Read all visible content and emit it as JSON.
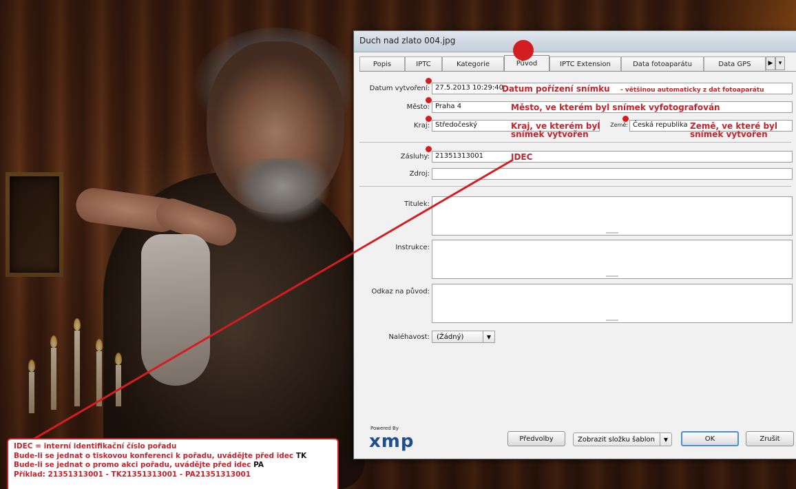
{
  "dialog": {
    "title": "Duch nad zlato 004.jpg",
    "tabs": [
      "Popis",
      "IPTC",
      "Kategorie",
      "Původ",
      "IPTC Extension",
      "Data fotoaparátu",
      "Data GPS"
    ],
    "active_tab": "Původ",
    "fields": {
      "datum_label": "Datum vytvoření:",
      "datum_value": "27.5.2013 10:29:40",
      "mesto_label": "Město:",
      "mesto_value": "Praha 4",
      "kraj_label": "Kraj:",
      "kraj_value": "Středočeský",
      "zeme_label": "Země:",
      "zeme_value": "Česká republika",
      "zasluhy_label": "Zásluhy:",
      "zasluhy_value": "21351313001",
      "zdroj_label": "Zdroj:",
      "titulek_label": "Titulek:",
      "instrukce_label": "Instrukce:",
      "odkaz_label": "Odkaz na původ:",
      "nalehavost_label": "Naléhavost:",
      "nalehavost_value": "(Žádný)"
    },
    "annotations": {
      "datum_main": "Datum pořízení snímku",
      "datum_sub": "- většinou automaticky z dat fotoaparátu",
      "mesto": "Město, ve kterém byl snímek vyfotografován",
      "kraj_line1": "Kraj, ve kterém byl",
      "kraj_line2": "snímek vytvořen",
      "zeme_line1": "Země, ve které byl",
      "zeme_line2": "snímek vytvořen",
      "idec": "IDEC"
    },
    "footer": {
      "powered_by": "Powered By",
      "logo": "xmp",
      "predvolby": "Předvolby",
      "zobrazit": "Zobrazit složku šablon",
      "ok": "OK",
      "zrusit": "Zrušit"
    }
  },
  "note": {
    "line1": "IDEC = interní identifikační číslo pořadu",
    "line2": "Bude-li se jednat o tiskovou konferenci k pořadu, uvádějte před idec",
    "line2_suffix": "TK",
    "line3": "Bude-li se jednat o promo akci pořadu, uvádějte před idec",
    "line3_suffix": "PA",
    "line4": "Příklad: 21351313001 - TK21351313001 - PA21351313001"
  },
  "colors": {
    "annotation_red": "#c4232b",
    "xmp_blue": "#1f4f8b",
    "ok_border": "#4a8fd0"
  }
}
